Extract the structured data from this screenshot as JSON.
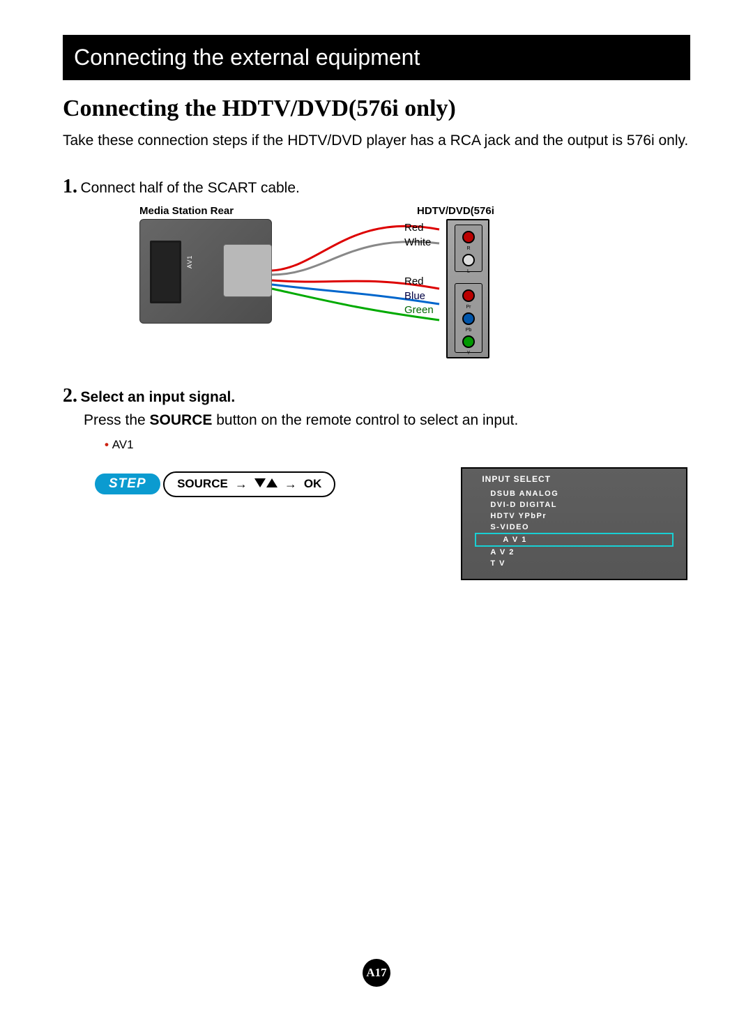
{
  "header": {
    "title": "Connecting the external equipment"
  },
  "main_heading": "Connecting the HDTV/DVD(576i only)",
  "intro": "Take these connection steps if the HDTV/DVD player has a RCA jack and the output is 576i only.",
  "step1": {
    "num": "1.",
    "text": " Connect half of the SCART cable."
  },
  "diagram": {
    "media_station_label": "Media Station Rear",
    "hdtv_label": "HDTV/DVD(576i",
    "av_port": "AV1",
    "wires": {
      "red1": "Red",
      "white": "White",
      "red2": "Red",
      "blue": "Blue",
      "green": "Green"
    },
    "rca_audio": {
      "r": "R",
      "l": "L"
    },
    "rca_component": {
      "pr": "Pr",
      "pb": "Pb",
      "y": "Y"
    }
  },
  "step2": {
    "num": "2.",
    "title": " Select an input signal.",
    "line_a": "Press the ",
    "source_word": "SOURCE",
    "line_b": " button on the remote control to select an input.",
    "bullet": "AV1"
  },
  "step_pill": "STEP",
  "source_oval": {
    "source": "SOURCE",
    "ok": "OK"
  },
  "osd": {
    "title": "INPUT SELECT",
    "items": [
      {
        "label": "DSUB ANALOG",
        "selected": false
      },
      {
        "label": "DVI-D DIGITAL",
        "selected": false
      },
      {
        "label": "HDTV YPbPr",
        "selected": false
      },
      {
        "label": "S-VIDEO",
        "selected": false
      },
      {
        "label": "A V 1",
        "selected": true
      },
      {
        "label": "A V 2",
        "selected": false
      },
      {
        "label": "T   V",
        "selected": false
      }
    ]
  },
  "page_number": "A17"
}
